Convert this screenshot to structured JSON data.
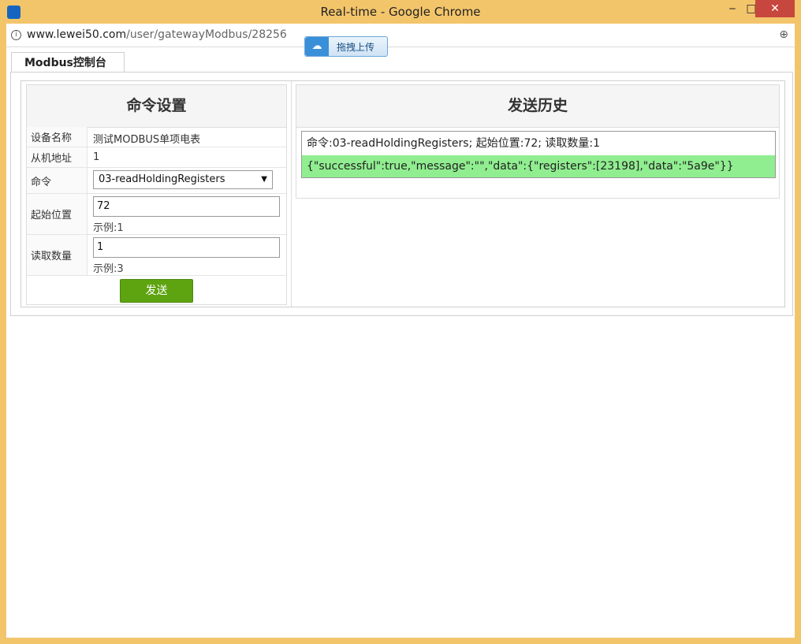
{
  "window": {
    "title": "Real-time - Google Chrome",
    "minimize": "‒",
    "maximize": "□",
    "close": "✕"
  },
  "address_bar": {
    "domain": "www.lewei50.com",
    "path": "/user/gatewayModbus/28256"
  },
  "upload": {
    "label": "拖拽上传"
  },
  "tab": {
    "label": "Modbus控制台"
  },
  "command_settings": {
    "title": "命令设置",
    "device_label": "设备名称",
    "device_value": "测试MODBUS单项电表",
    "slave_label": "从机地址",
    "slave_value": "1",
    "command_label": "命令",
    "command_value": "03-readHoldingRegisters",
    "start_label": "起始位置",
    "start_value": "72",
    "start_hint": "示例:1",
    "count_label": "读取数量",
    "count_value": "1",
    "count_hint": "示例:3",
    "send_label": "发送"
  },
  "history": {
    "title": "发送历史",
    "command_line": "命令:03-readHoldingRegisters; 起始位置:72; 读取数量:1",
    "response_line": "{\"successful\":true,\"message\":\"\",\"data\":{\"registers\":[23198],\"data\":\"5a9e\"}}"
  },
  "colors": {
    "frame": "#f3c56b",
    "send_button": "#5ea310",
    "response_bg": "#90ee90"
  }
}
